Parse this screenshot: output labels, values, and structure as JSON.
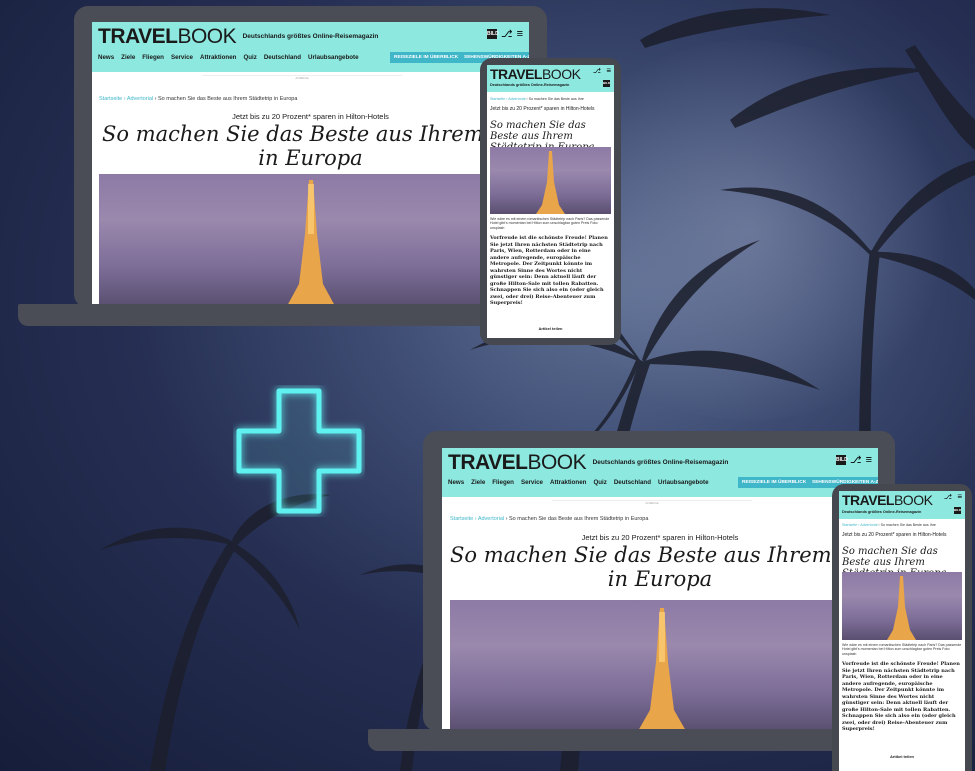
{
  "brand": {
    "logo_bold": "TRAVEL",
    "logo_thin": "BOOK",
    "tagline": "Deutschlands größtes Online-Reisemagazin",
    "mobile_tagline": "Deutschlands größtes Online-Reisemagazin",
    "bild_small": "Eine Marke von",
    "bild": "BILD"
  },
  "nav": {
    "items": [
      "News",
      "Ziele",
      "Fliegen",
      "Service",
      "Attraktionen",
      "Quiz",
      "Deutschland",
      "Urlaubsangebote"
    ],
    "btn1": "REISEZIELE IM ÜBERBLICK",
    "btn2": "SEHENSWÜRDIGKEITEN A-Z",
    "ad_label": "ANZEIGE"
  },
  "article": {
    "breadcrumb": {
      "home": "Startseite",
      "sep": " › ",
      "section": "Advertorial",
      "current": "So machen Sie das Beste aus Ihrem Städtetrip in Europa",
      "current_mobile": "So machen Sie das Beste aus Ihre"
    },
    "kicker": "Jetzt bis zu 20 Prozent* sparen in Hilton-Hotels",
    "headline_line1": "So machen Sie das Beste aus Ihrem Städte",
    "headline_line2": "in Europa",
    "headline_top1": "So machen Sie das Beste aus Ihrem Städt",
    "mobile_headline": "So machen Sie das Beste aus Ihrem Städtetrip in Europa",
    "caption": "Wie wäre es mit einem romantischen Städtetrip nach Paris? Das passende Hotel gibt's momentan bei Hilton zum unschlagbar guten Preis",
    "photo_credit": "Foto: unsplash",
    "body": "Vorfreude ist die schönste Freude! Planen Sie jetzt Ihren nächsten Städtetrip nach Paris, Wien, Rotterdam oder in eine andere aufregende, europäische Metropole. Der Zeitpunkt könnte im wahrsten Sinne des Wortes nicht günstiger sein: Denn aktuell läuft der große Hilton-Sale mit tollen Rabatten. Schnappen Sie sich also ein (oder gleich zwei, oder drei) Reise-Abenteuer zum Superpreis!",
    "share": "Artikel teilen"
  },
  "icons": {
    "bell": "bell-icon",
    "menu": "menu-icon",
    "plus": "plus-icon"
  },
  "colors": {
    "header": "#8de8df",
    "accent": "#3fb7c9",
    "plus_glow": "#5ff0f0",
    "device": "#4a4d55"
  }
}
